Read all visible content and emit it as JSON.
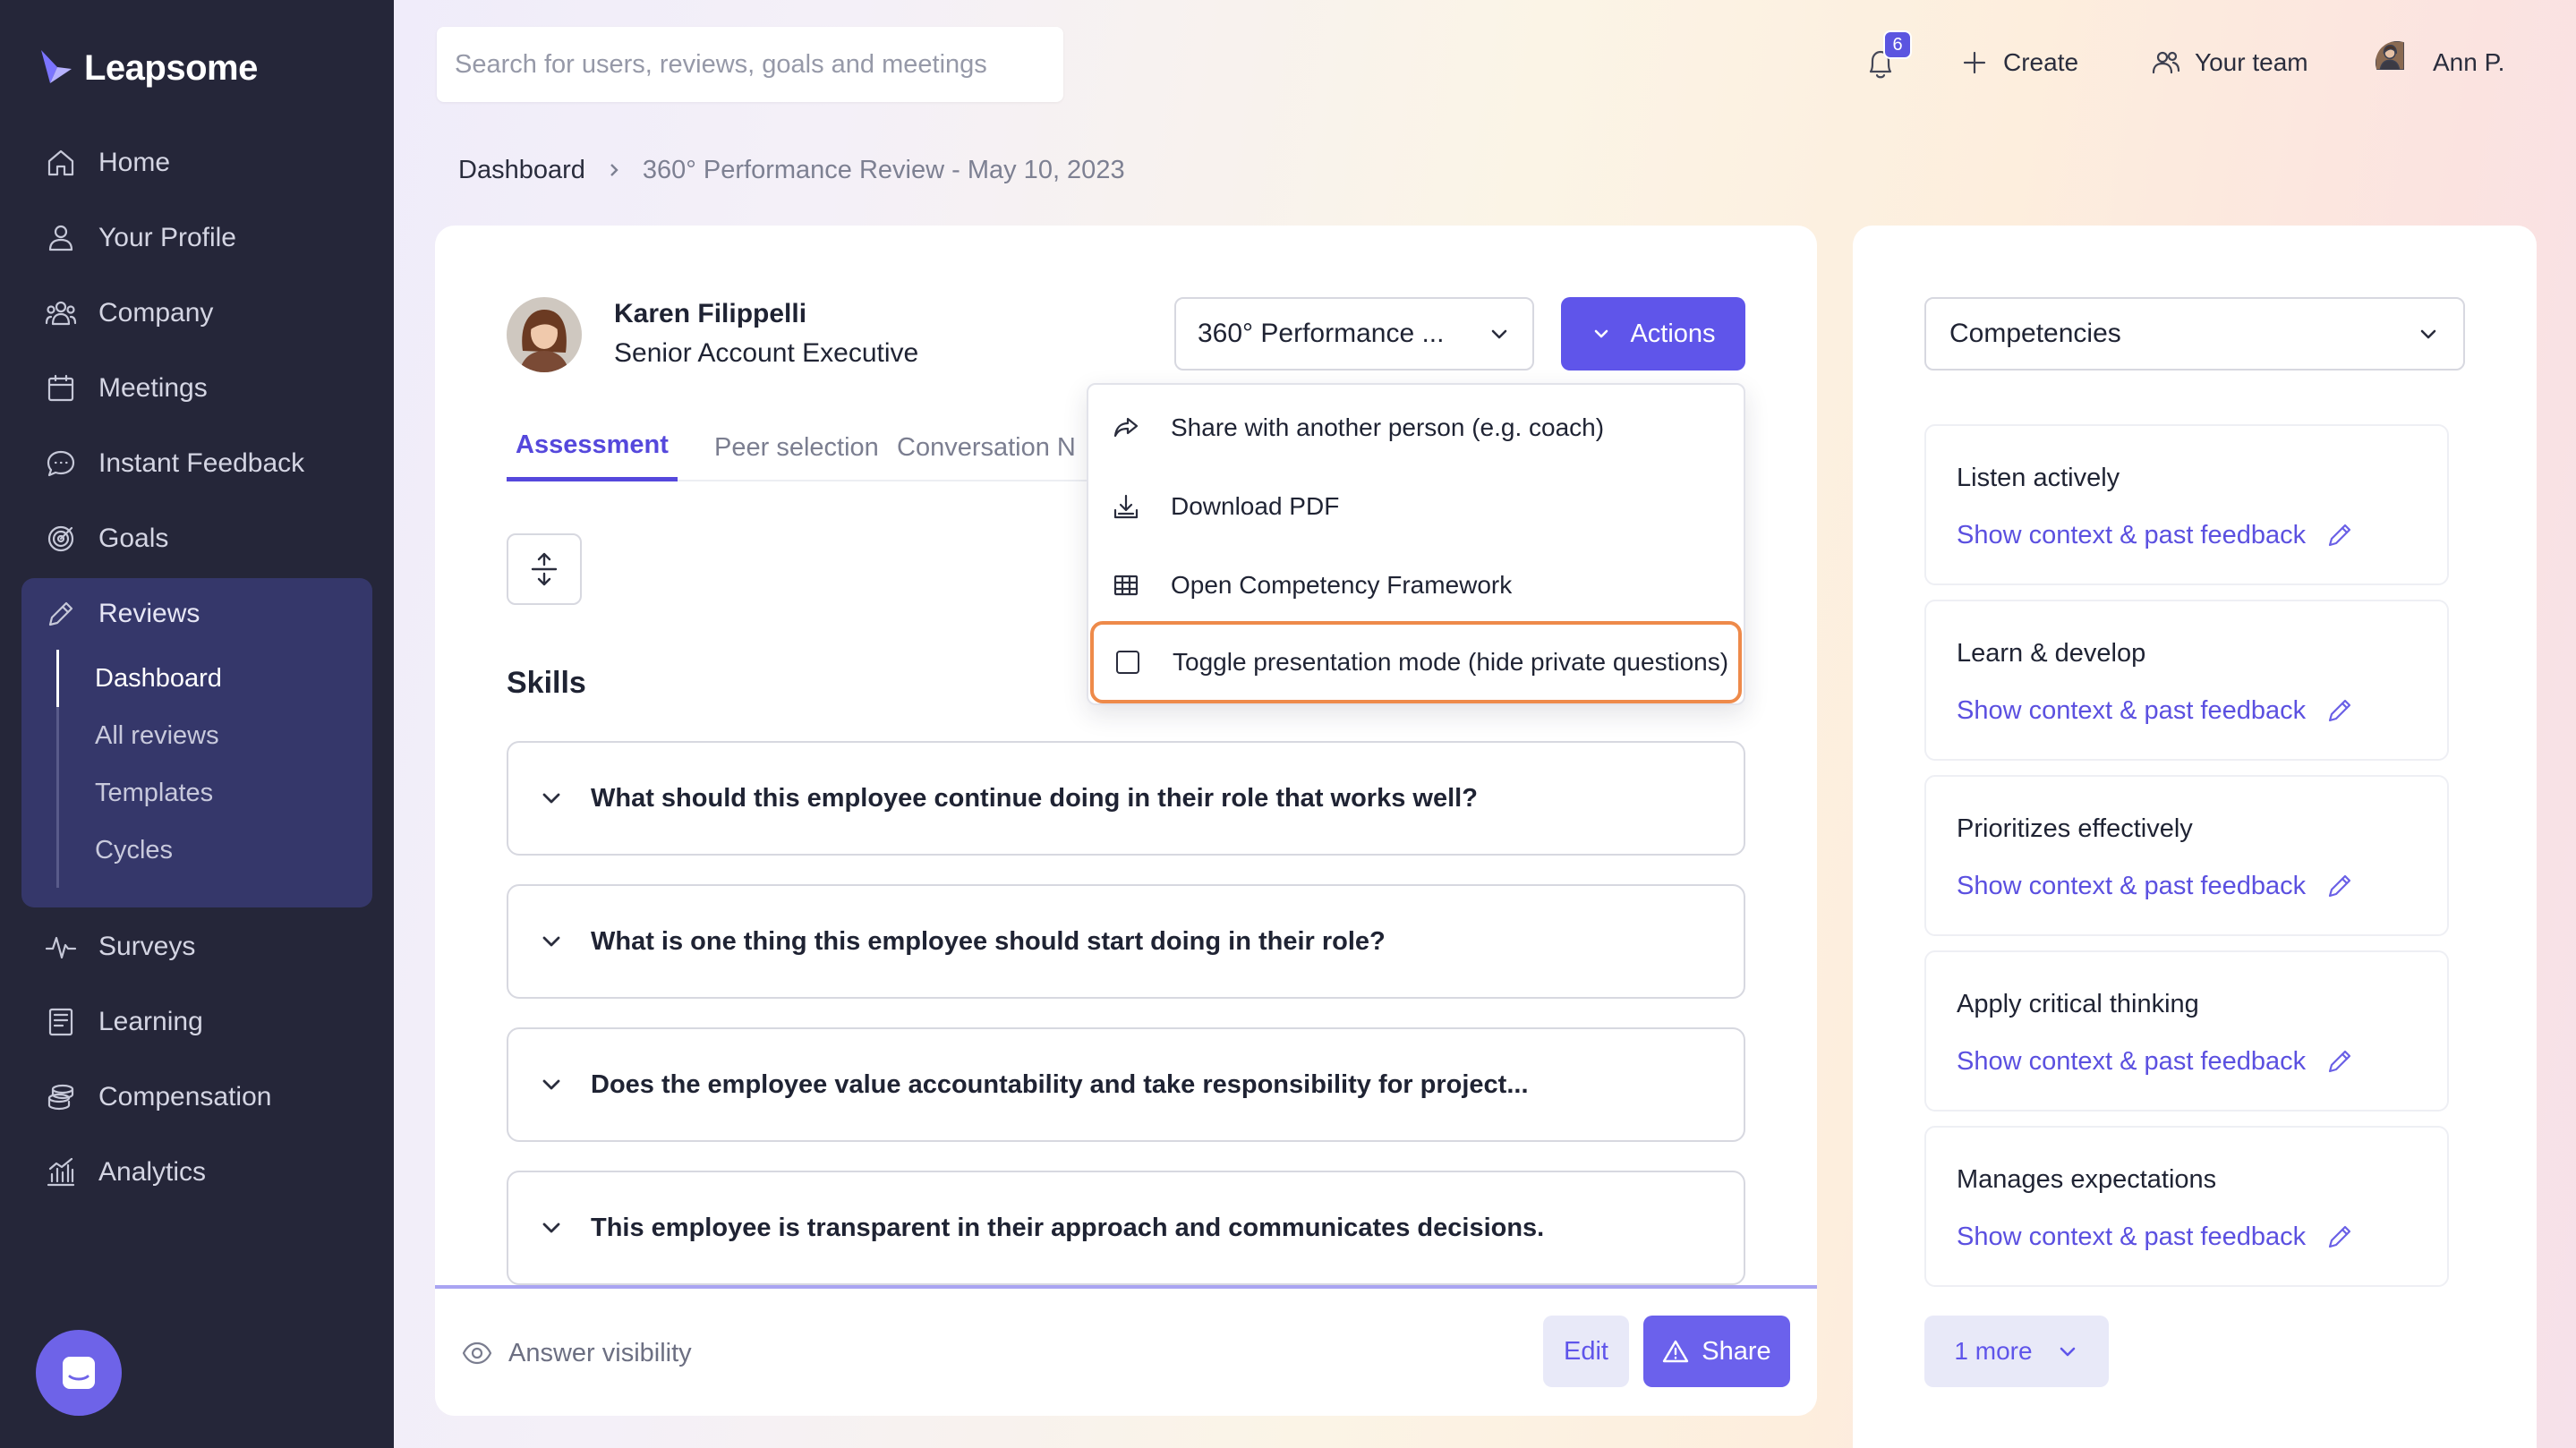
{
  "app": {
    "name": "Leapsome"
  },
  "sidebar": {
    "items": [
      {
        "label": "Home",
        "icon": "home-icon"
      },
      {
        "label": "Your Profile",
        "icon": "user-icon"
      },
      {
        "label": "Company",
        "icon": "people-icon"
      },
      {
        "label": "Meetings",
        "icon": "calendar-icon"
      },
      {
        "label": "Instant Feedback",
        "icon": "chat-icon"
      },
      {
        "label": "Goals",
        "icon": "target-icon"
      },
      {
        "label": "Reviews",
        "icon": "pencil-icon",
        "active": true
      },
      {
        "label": "Surveys",
        "icon": "pulse-icon"
      },
      {
        "label": "Learning",
        "icon": "book-icon"
      },
      {
        "label": "Compensation",
        "icon": "coins-icon"
      },
      {
        "label": "Analytics",
        "icon": "bar-chart-icon"
      }
    ],
    "reviews_sub": [
      "Dashboard",
      "All reviews",
      "Templates",
      "Cycles"
    ],
    "reviews_sub_active": "Dashboard"
  },
  "topbar": {
    "search_placeholder": "Search for users, reviews, goals and meetings",
    "notifications_count": "6",
    "create_label": "Create",
    "team_label": "Your team",
    "user_label": "Ann P."
  },
  "breadcrumb": {
    "root": "Dashboard",
    "current": "360° Performance Review - May 10, 2023"
  },
  "profile": {
    "name": "Karen Filippelli",
    "title": "Senior Account Executive"
  },
  "review_select": {
    "value": "360° Performance ..."
  },
  "actions": {
    "label": "Actions",
    "menu": [
      {
        "label": "Share with another person (e.g. coach)",
        "icon": "share-arrow-icon"
      },
      {
        "label": "Download PDF",
        "icon": "download-icon"
      },
      {
        "label": "Open Competency Framework",
        "icon": "grid-icon"
      },
      {
        "label": "Toggle presentation mode (hide private questions)",
        "icon": "checkbox-icon",
        "highlighted": true
      }
    ]
  },
  "tabs": [
    {
      "label": "Assessment",
      "active": true
    },
    {
      "label": "Peer selection"
    },
    {
      "label": "Conversation N"
    }
  ],
  "section_title": "Skills",
  "questions": [
    "What should this employee continue doing in their role that works well?",
    "What is one thing this employee should start doing in their role?",
    "Does the employee value accountability and take responsibility for project...",
    "This employee is transparent in their approach and communicates decisions."
  ],
  "footer": {
    "visibility_label": "Answer visibility",
    "edit_label": "Edit",
    "share_label": "Share"
  },
  "competencies": {
    "select_value": "Competencies",
    "items": [
      {
        "title": "Listen actively",
        "link": "Show context & past feedback"
      },
      {
        "title": "Learn & develop",
        "link": "Show context & past feedback"
      },
      {
        "title": "Prioritizes effectively",
        "link": "Show context & past feedback"
      },
      {
        "title": "Apply critical thinking",
        "link": "Show context & past feedback"
      },
      {
        "title": "Manages expectations",
        "link": "Show context & past feedback"
      }
    ],
    "more_label": "1 more"
  },
  "colors": {
    "accent": "#5f55ea",
    "sidebar_bg": "#252639",
    "highlight_border": "#ee8a4a"
  }
}
